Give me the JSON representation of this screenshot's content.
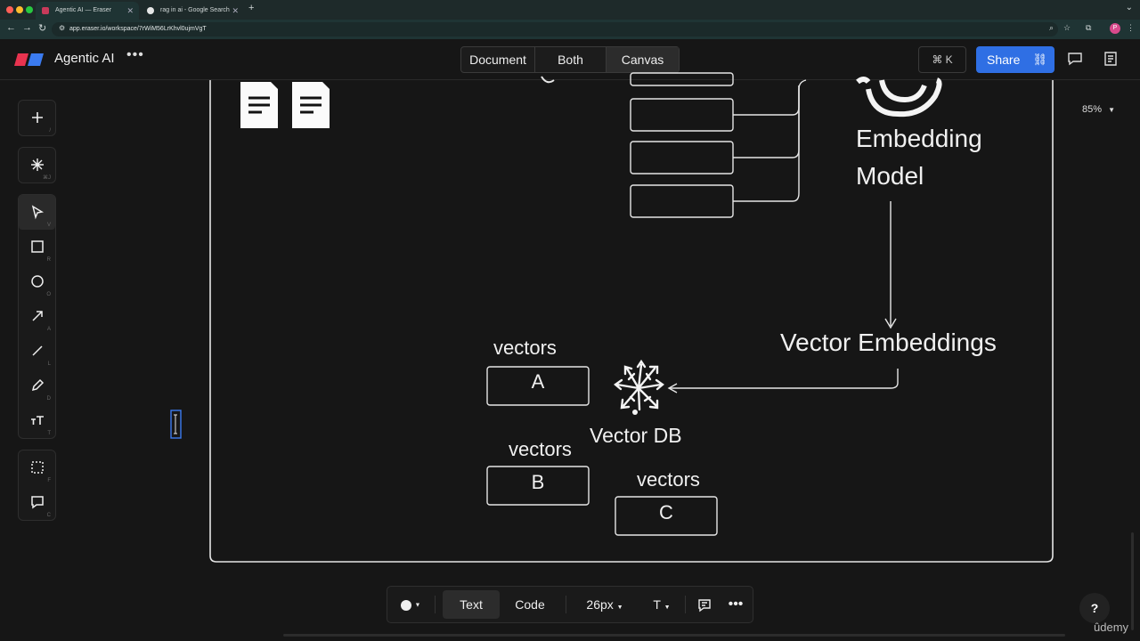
{
  "browser": {
    "tabs": [
      {
        "title": "Agentic AI — Eraser",
        "active": true
      },
      {
        "title": "rag in ai - Google Search",
        "active": false
      }
    ],
    "new_tab": "+",
    "url": "app.eraser.io/workspace/7rWiM56LrKhvl0ujmVgT",
    "profile_initial": "P"
  },
  "header": {
    "doc_title": "Agentic AI",
    "more": "•••",
    "views": [
      "Document",
      "Both",
      "Canvas"
    ],
    "active_view": "Canvas",
    "command": "⌘ K",
    "share": "Share"
  },
  "toolbar": {
    "keys": [
      "/",
      "⌘J",
      "V",
      "R",
      "O",
      "A",
      "L",
      "D",
      "T",
      "F",
      "C"
    ]
  },
  "canvas": {
    "zoom": "85%",
    "model_label_1": "Embedding",
    "model_label_2": "Model",
    "embeddings_label": "Vector Embeddings",
    "db_label": "Vector DB",
    "vectors_a_label": "vectors",
    "vectors_a": "A",
    "vectors_b_label": "vectors",
    "vectors_b": "B",
    "vectors_c_label": "vectors",
    "vectors_c": "C"
  },
  "bottom_bar": {
    "text_tab": "Text",
    "code_tab": "Code",
    "font_size": "26px",
    "font_style": "T"
  },
  "help": "?",
  "watermark": "ûdemy"
}
